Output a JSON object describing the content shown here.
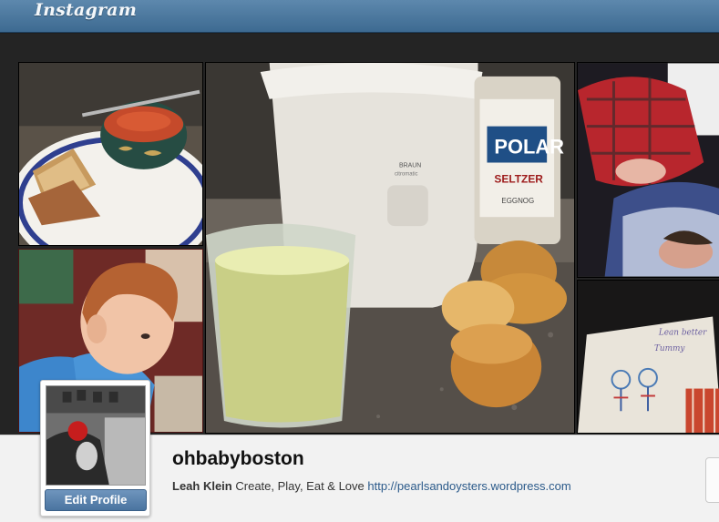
{
  "header": {
    "logo": "Instagram"
  },
  "profile": {
    "username": "ohbabyboston",
    "full_name": "Leah Klein",
    "bio": "Create, Play, Eat & Love",
    "website": "http://pearlsandoysters.wordpress.com",
    "edit_label": "Edit Profile"
  },
  "photos": {
    "juicer_brand": "BRAUN",
    "juicer_model": "citromatic",
    "bottle_brand": "POLAR",
    "bottle_type": "SELTZER",
    "bottle_flavor": "EGGNOG",
    "note_line1": "Lean better",
    "note_line2": "Tummy"
  }
}
